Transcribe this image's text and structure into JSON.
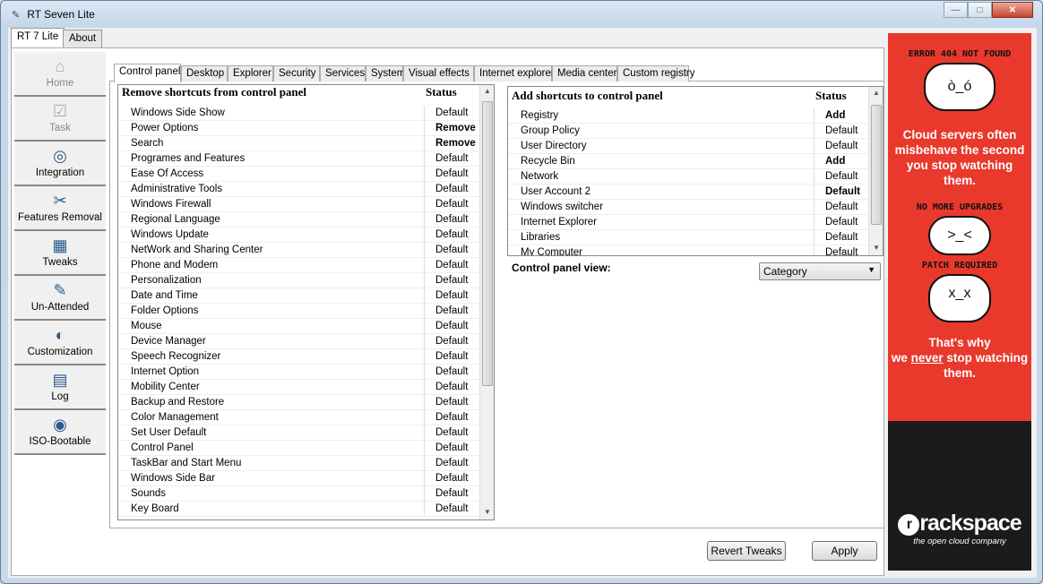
{
  "window": {
    "title": "RT Seven Lite"
  },
  "outer_tabs": [
    "RT 7 Lite",
    "About"
  ],
  "sidebar": [
    {
      "label": "Home",
      "icon": "home-icon",
      "glyph": "⌂",
      "disabled": true
    },
    {
      "label": "Task",
      "icon": "task-icon",
      "glyph": "☑",
      "disabled": true
    },
    {
      "label": "Integration",
      "icon": "integration-icon",
      "glyph": "◎",
      "disabled": false
    },
    {
      "label": "Features Removal",
      "icon": "features-removal-icon",
      "glyph": "✂",
      "disabled": false
    },
    {
      "label": "Tweaks",
      "icon": "tweaks-icon",
      "glyph": "▦",
      "disabled": false
    },
    {
      "label": "Un-Attended",
      "icon": "unattended-icon",
      "glyph": "✎",
      "disabled": false
    },
    {
      "label": "Customization",
      "icon": "customization-icon",
      "glyph": "◐",
      "disabled": false
    },
    {
      "label": "Log",
      "icon": "log-icon",
      "glyph": "▤",
      "disabled": false
    },
    {
      "label": "ISO-Bootable",
      "icon": "iso-disc-icon",
      "glyph": "◉",
      "disabled": false
    }
  ],
  "inner_tabs": [
    "Control panel",
    "Desktop",
    "Explorer",
    "Security",
    "Services",
    "System",
    "Visual effects",
    "Internet explorer",
    "Media center",
    "Custom registry"
  ],
  "remove_list": {
    "title": "Remove shortcuts from control panel",
    "status_header": "Status",
    "rows": [
      [
        "Windows Side Show",
        "Default"
      ],
      [
        "Power Options",
        "Remove"
      ],
      [
        "Search",
        "Remove"
      ],
      [
        "Programes and Features",
        "Default"
      ],
      [
        "Ease Of Access",
        "Default"
      ],
      [
        "Administrative Tools",
        "Default"
      ],
      [
        "Windows Firewall",
        "Default"
      ],
      [
        "Regional Language",
        "Default"
      ],
      [
        "Windows Update",
        "Default"
      ],
      [
        "NetWork and Sharing Center",
        "Default"
      ],
      [
        "Phone and Modem",
        "Default"
      ],
      [
        "Personalization",
        "Default"
      ],
      [
        "Date and Time",
        "Default"
      ],
      [
        "Folder Options",
        "Default"
      ],
      [
        "Mouse",
        "Default"
      ],
      [
        "Device Manager",
        "Default"
      ],
      [
        "Speech Recognizer",
        "Default"
      ],
      [
        "Internet Option",
        "Default"
      ],
      [
        "Mobility Center",
        "Default"
      ],
      [
        "Backup and Restore",
        "Default"
      ],
      [
        "Color Management",
        "Default"
      ],
      [
        "Set User Default",
        "Default"
      ],
      [
        "Control Panel",
        "Default"
      ],
      [
        "TaskBar and Start Menu",
        "Default"
      ],
      [
        "Windows Side Bar",
        "Default"
      ],
      [
        "Sounds",
        "Default"
      ],
      [
        "Key Board",
        "Default"
      ]
    ]
  },
  "add_list": {
    "title": "Add shortcuts to control panel",
    "status_header": "Status",
    "rows": [
      [
        "Registry",
        "Add"
      ],
      [
        "Group Policy",
        "Default"
      ],
      [
        "User Directory",
        "Default"
      ],
      [
        "Recycle Bin",
        "Add"
      ],
      [
        "Network",
        "Default"
      ],
      [
        "User Account 2",
        "Default"
      ],
      [
        "Windows switcher",
        "Default"
      ],
      [
        "Internet Explorer",
        "Default"
      ],
      [
        "Libraries",
        "Default"
      ],
      [
        "My Computer",
        "Default"
      ]
    ]
  },
  "view": {
    "label": "Control panel view:",
    "value": "Category"
  },
  "buttons": {
    "revert": "Revert Tweaks",
    "apply": "Apply"
  },
  "ad": {
    "hand1": "ERROR 404 NOT FOUND",
    "text1": "Cloud servers often misbehave the second you stop watching them.",
    "hand2": "NO MORE UPGRADES",
    "hand3": "PATCH REQUIRED",
    "text2a": "That's why",
    "text2b": "we ",
    "text2c": "never",
    "text2d": " stop watching them.",
    "brand": "rackspace",
    "tagline": "the open cloud company",
    "color": "#e8392c"
  }
}
